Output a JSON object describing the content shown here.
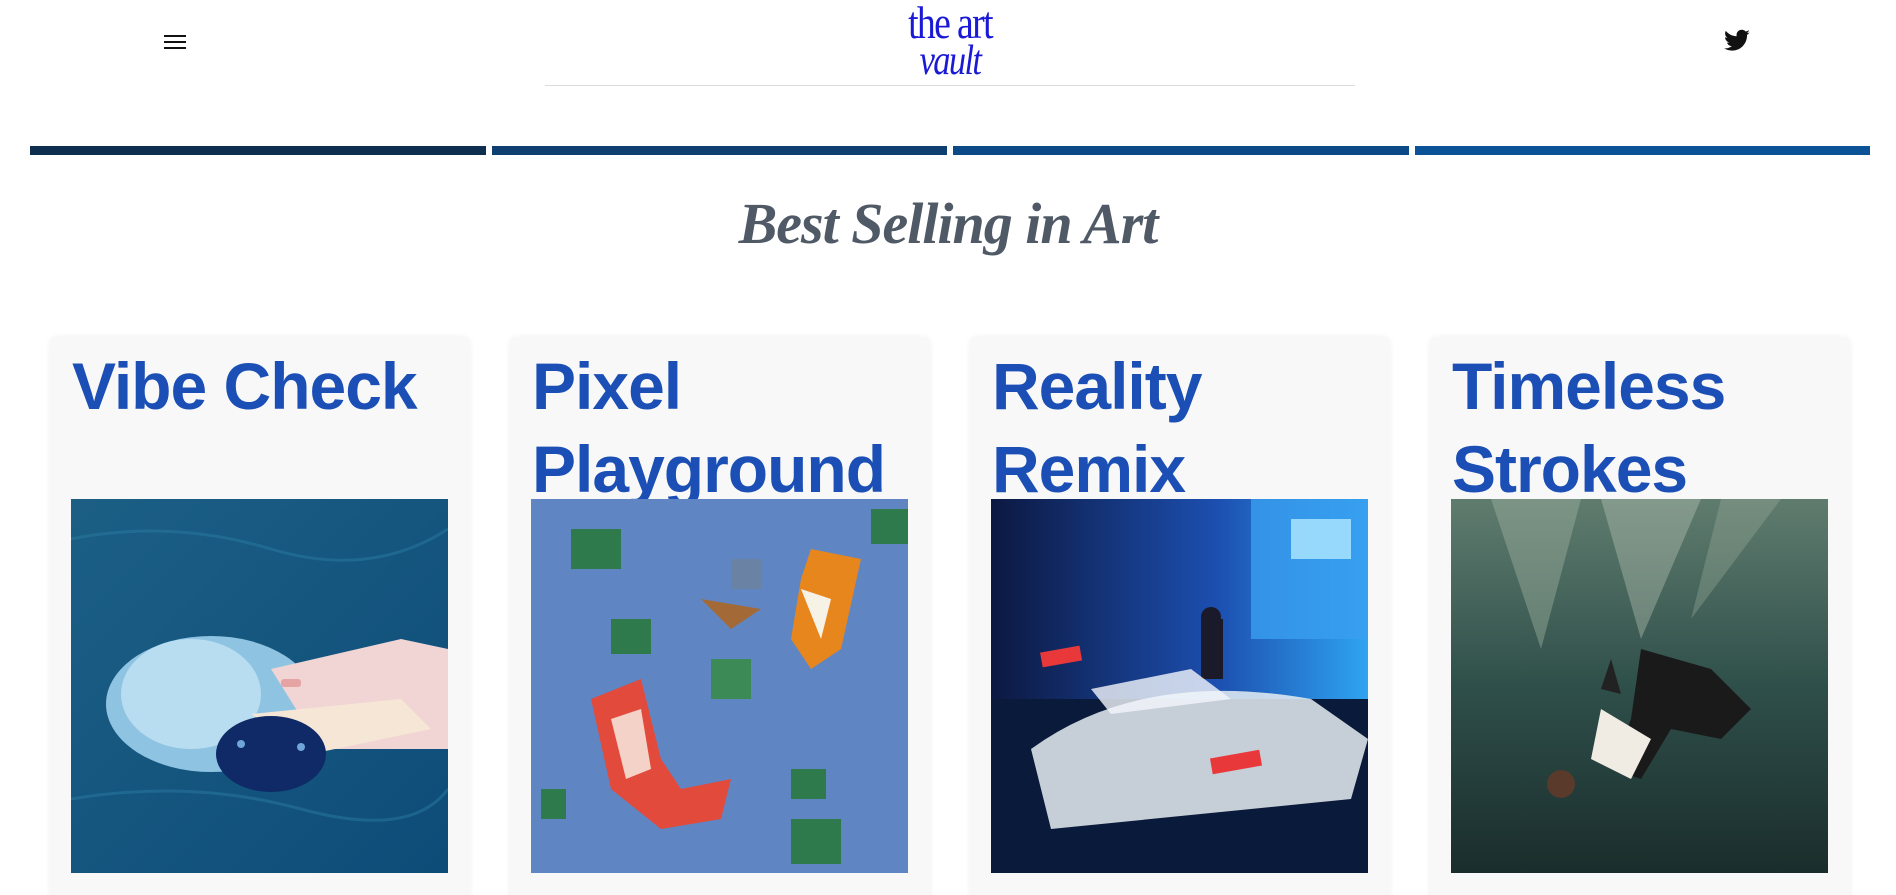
{
  "header": {
    "logo_line1": "the art",
    "logo_line2": "vault",
    "menu_icon": "hamburger-menu-icon",
    "social_icon": "twitter-icon"
  },
  "tabs": [
    {
      "color": "#0d2e4f"
    },
    {
      "color": "#0e3f70"
    },
    {
      "color": "#0b4a86"
    },
    {
      "color": "#0b5296"
    }
  ],
  "section": {
    "title": "Best Selling in Art"
  },
  "cards": [
    {
      "title": "Vibe Check",
      "image": "sleeping-girl-with-cat-painting"
    },
    {
      "title": "Pixel Playground",
      "image": "pixel-koi-pond"
    },
    {
      "title": "Reality Remix",
      "image": "night-street-motion-blur-photo"
    },
    {
      "title": "Timeless Strokes",
      "image": "falling-figure-underwater-painting"
    }
  ],
  "colors": {
    "brand": "#1a1ad6",
    "card_title": "#1b4fb5",
    "section_title": "#505a66"
  }
}
